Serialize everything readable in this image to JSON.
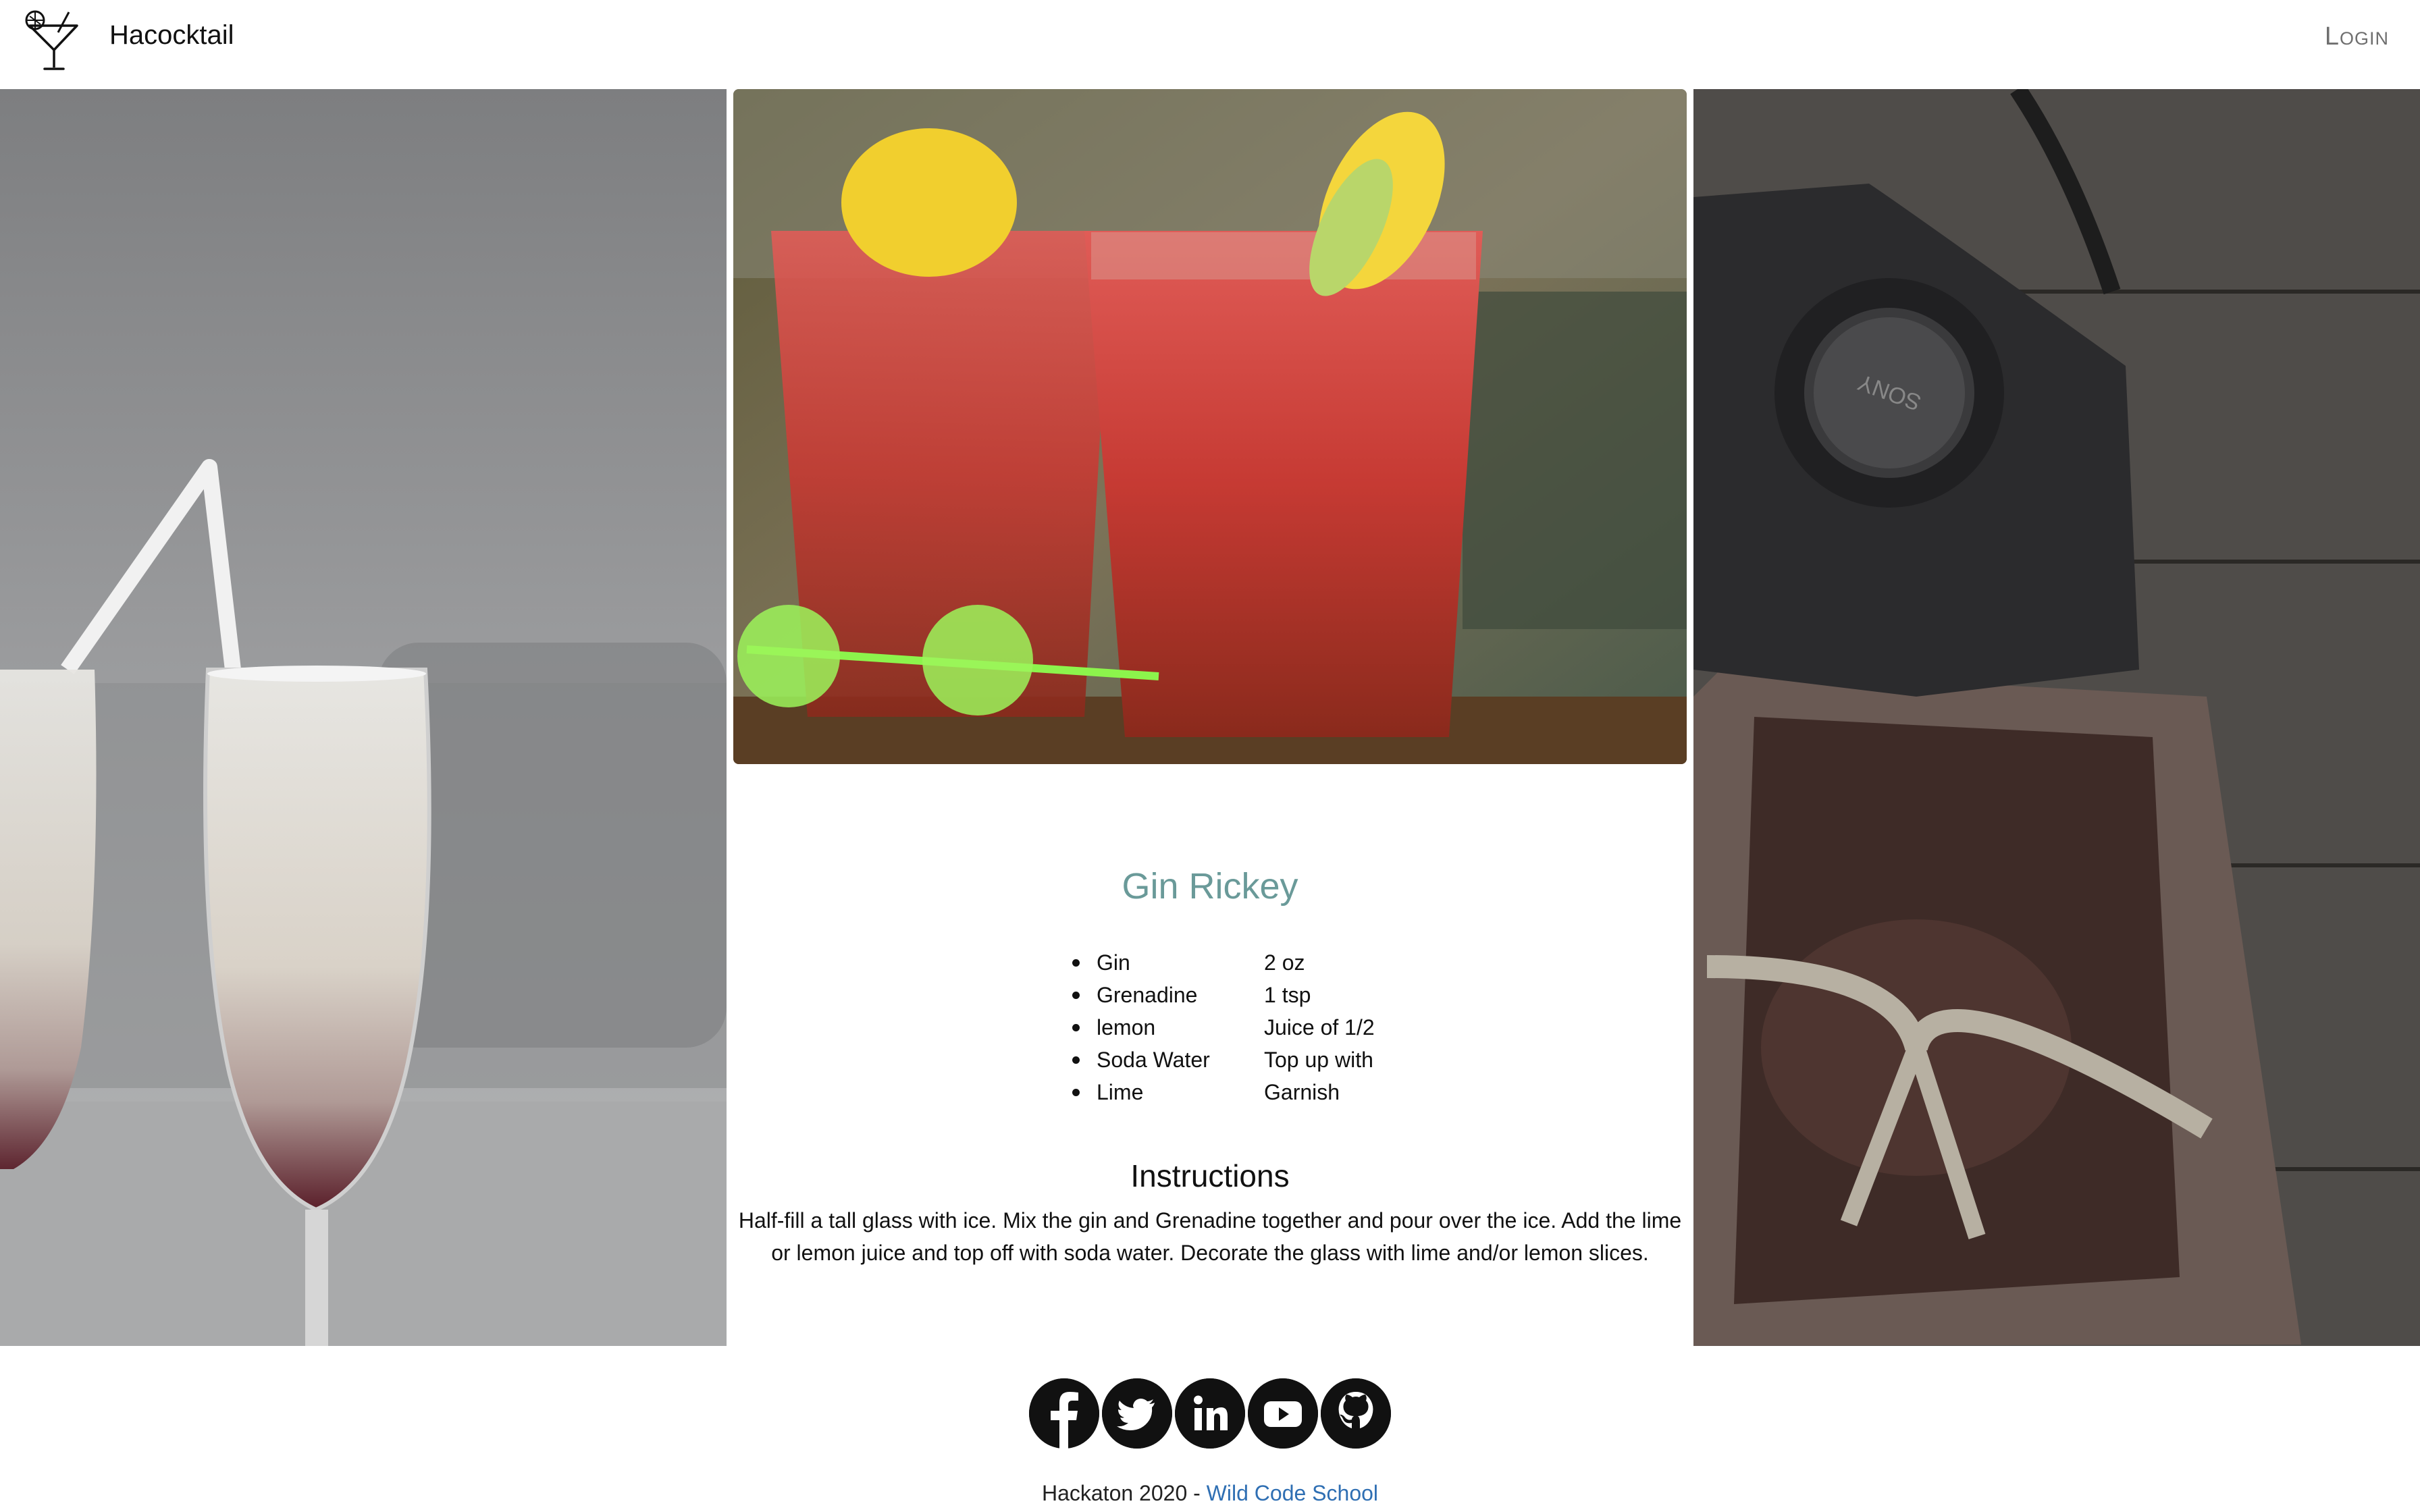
{
  "header": {
    "brand_name": "Hacocktail",
    "login_label": "Login"
  },
  "drink": {
    "name": "Gin Rickey",
    "ingredients": [
      {
        "name": "Gin",
        "measure": "2 oz"
      },
      {
        "name": "Grenadine",
        "measure": "1 tsp"
      },
      {
        "name": "lemon",
        "measure": "Juice of 1/2"
      },
      {
        "name": "Soda Water",
        "measure": "Top up with"
      },
      {
        "name": "Lime",
        "measure": "Garnish"
      }
    ],
    "instructions_heading": "Instructions",
    "instructions": "Half-fill a tall glass with ice. Mix the gin and Grenadine together and pour over the ice. Add the lime or lemon juice and top off with soda water. Decorate the glass with lime and/or lemon slices."
  },
  "camera_brand": "SONY",
  "footer": {
    "social_icons": [
      "facebook-icon",
      "twitter-icon",
      "linkedin-icon",
      "youtube-icon",
      "github-icon"
    ],
    "credit_prefix": "Hackaton 2020 - ",
    "credit_link": "Wild Code School"
  },
  "colors": {
    "title_teal": "#6a9a99",
    "link_blue": "#2f6fb3",
    "login_gray": "#6f6f6f"
  }
}
